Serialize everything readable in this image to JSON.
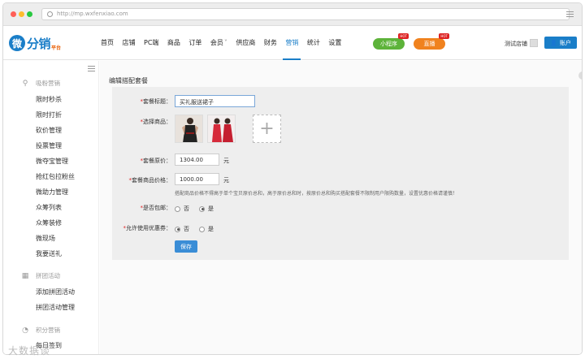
{
  "browser": {
    "url": "http://mp.wxfenxiao.com"
  },
  "logo": {
    "main": "分销",
    "sub": "平台",
    "mark": "微"
  },
  "nav": {
    "items": [
      "首页",
      "店铺",
      "PC端",
      "商品",
      "订单",
      "会员",
      "供应商",
      "财务",
      "营销",
      "统计",
      "设置"
    ],
    "active": "营销",
    "member_arrow": "˅",
    "miniprogram": "小程序",
    "direct_seeding": "直播",
    "hot_badge": "HOT",
    "test_store": "测试店铺",
    "account": "账户"
  },
  "sidebar": {
    "sections": [
      {
        "icon": "promotion-icon",
        "label": "吸粉营销",
        "items": [
          "限时秒杀",
          "限时打折",
          "砍价管理",
          "投票管理",
          "微夺宝管理",
          "抢红包拉粉丝",
          "微助力管理",
          "众筹列表",
          "众筹装修",
          "微现场",
          "我要送礼"
        ]
      },
      {
        "icon": "group-icon",
        "label": "拼团活动",
        "items": [
          "添加拼团活动",
          "拼团活动管理"
        ]
      },
      {
        "icon": "points-icon",
        "label": "积分营销",
        "items": [
          "每日签到"
        ]
      }
    ]
  },
  "form": {
    "title": "编辑搭配套餐",
    "package_title_label": "套餐标题：",
    "package_title_value": "买礼服送裙子",
    "choose_goods_label": "选择商品：",
    "original_price_label": "套餐原价：",
    "original_price_value": "1304.00",
    "package_price_label": "套餐商品价格：",
    "package_price_value": "1000.00",
    "unit": "元",
    "hint": "搭配商品价格不得高于单个宝贝原价总和，高于原价总和时，按原价总和购买搭配套餐不限制用户限购数量，设置优惠价格请谨慎！",
    "free_shipping_label": "是否包邮：",
    "coupon_label": "允许使用优惠券：",
    "no": "否",
    "yes": "是",
    "free_shipping": "是",
    "allow_coupon": "否",
    "save": "保存"
  },
  "watermark": "大数据谈"
}
